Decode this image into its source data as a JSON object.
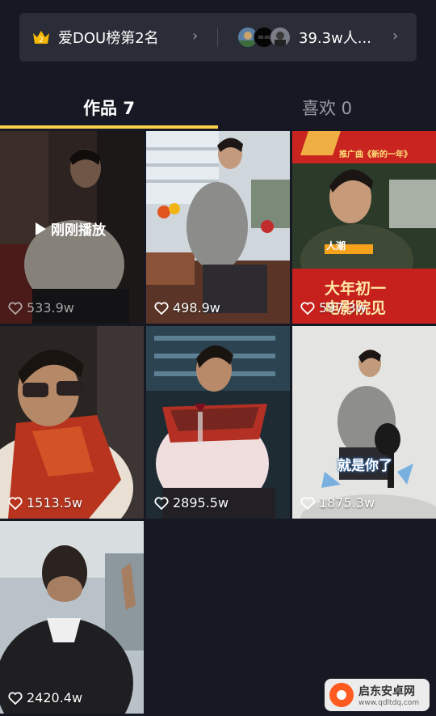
{
  "stats": {
    "rank_badge": "2",
    "rank_label": "爱DOU榜第2名",
    "fans_label": "39.3w人...",
    "fan_avatar_badge": "88.66"
  },
  "tabs": [
    {
      "label": "作品 7",
      "active": true
    },
    {
      "label": "喜欢 0",
      "active": false
    }
  ],
  "videos": [
    {
      "likes": "533.9w",
      "just_played": "刚刚播放"
    },
    {
      "likes": "498.9w"
    },
    {
      "likes": "597.3w",
      "captions": [
        "大年初一",
        "电影院见"
      ],
      "top_caption": "推广曲《新的一年》",
      "sticker": "人潮"
    },
    {
      "likes": "1513.5w"
    },
    {
      "likes": "2895.5w"
    },
    {
      "likes": "1875.3w",
      "caption": "就是你了"
    },
    {
      "likes": "2420.4w"
    }
  ],
  "watermark": {
    "title": "启东安卓网",
    "url": "www.qdltdq.com"
  },
  "colors": {
    "background": "#161823",
    "accent": "#fccf4d",
    "card": "#2a2c37"
  }
}
